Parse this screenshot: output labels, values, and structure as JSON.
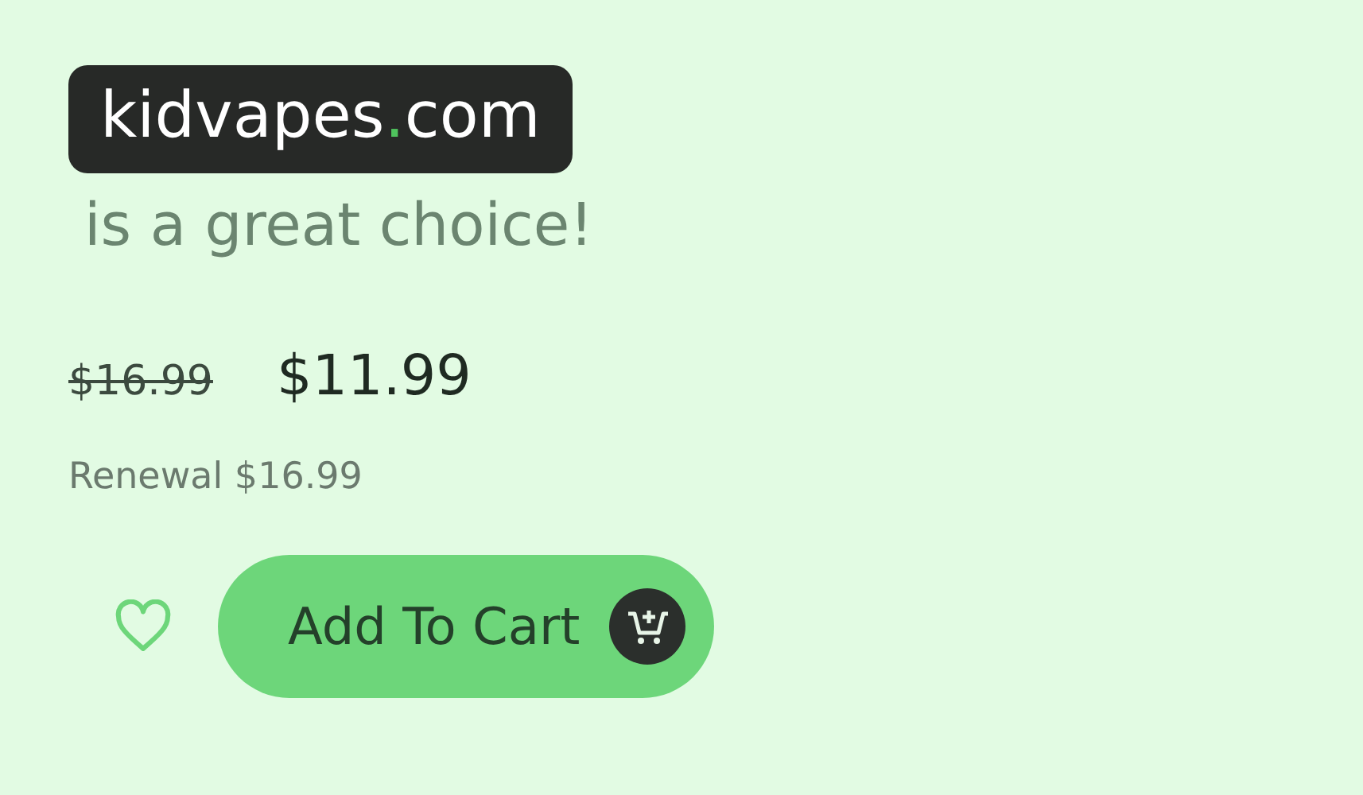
{
  "domain": {
    "name": "kidvapes",
    "separator": ".",
    "tld": "com"
  },
  "tagline": "is a great choice!",
  "price": {
    "original": "$16.99",
    "current": "$11.99"
  },
  "renewal": "Renewal $16.99",
  "favorite": {
    "saved": false
  },
  "button": {
    "label": "Add To Cart"
  }
}
